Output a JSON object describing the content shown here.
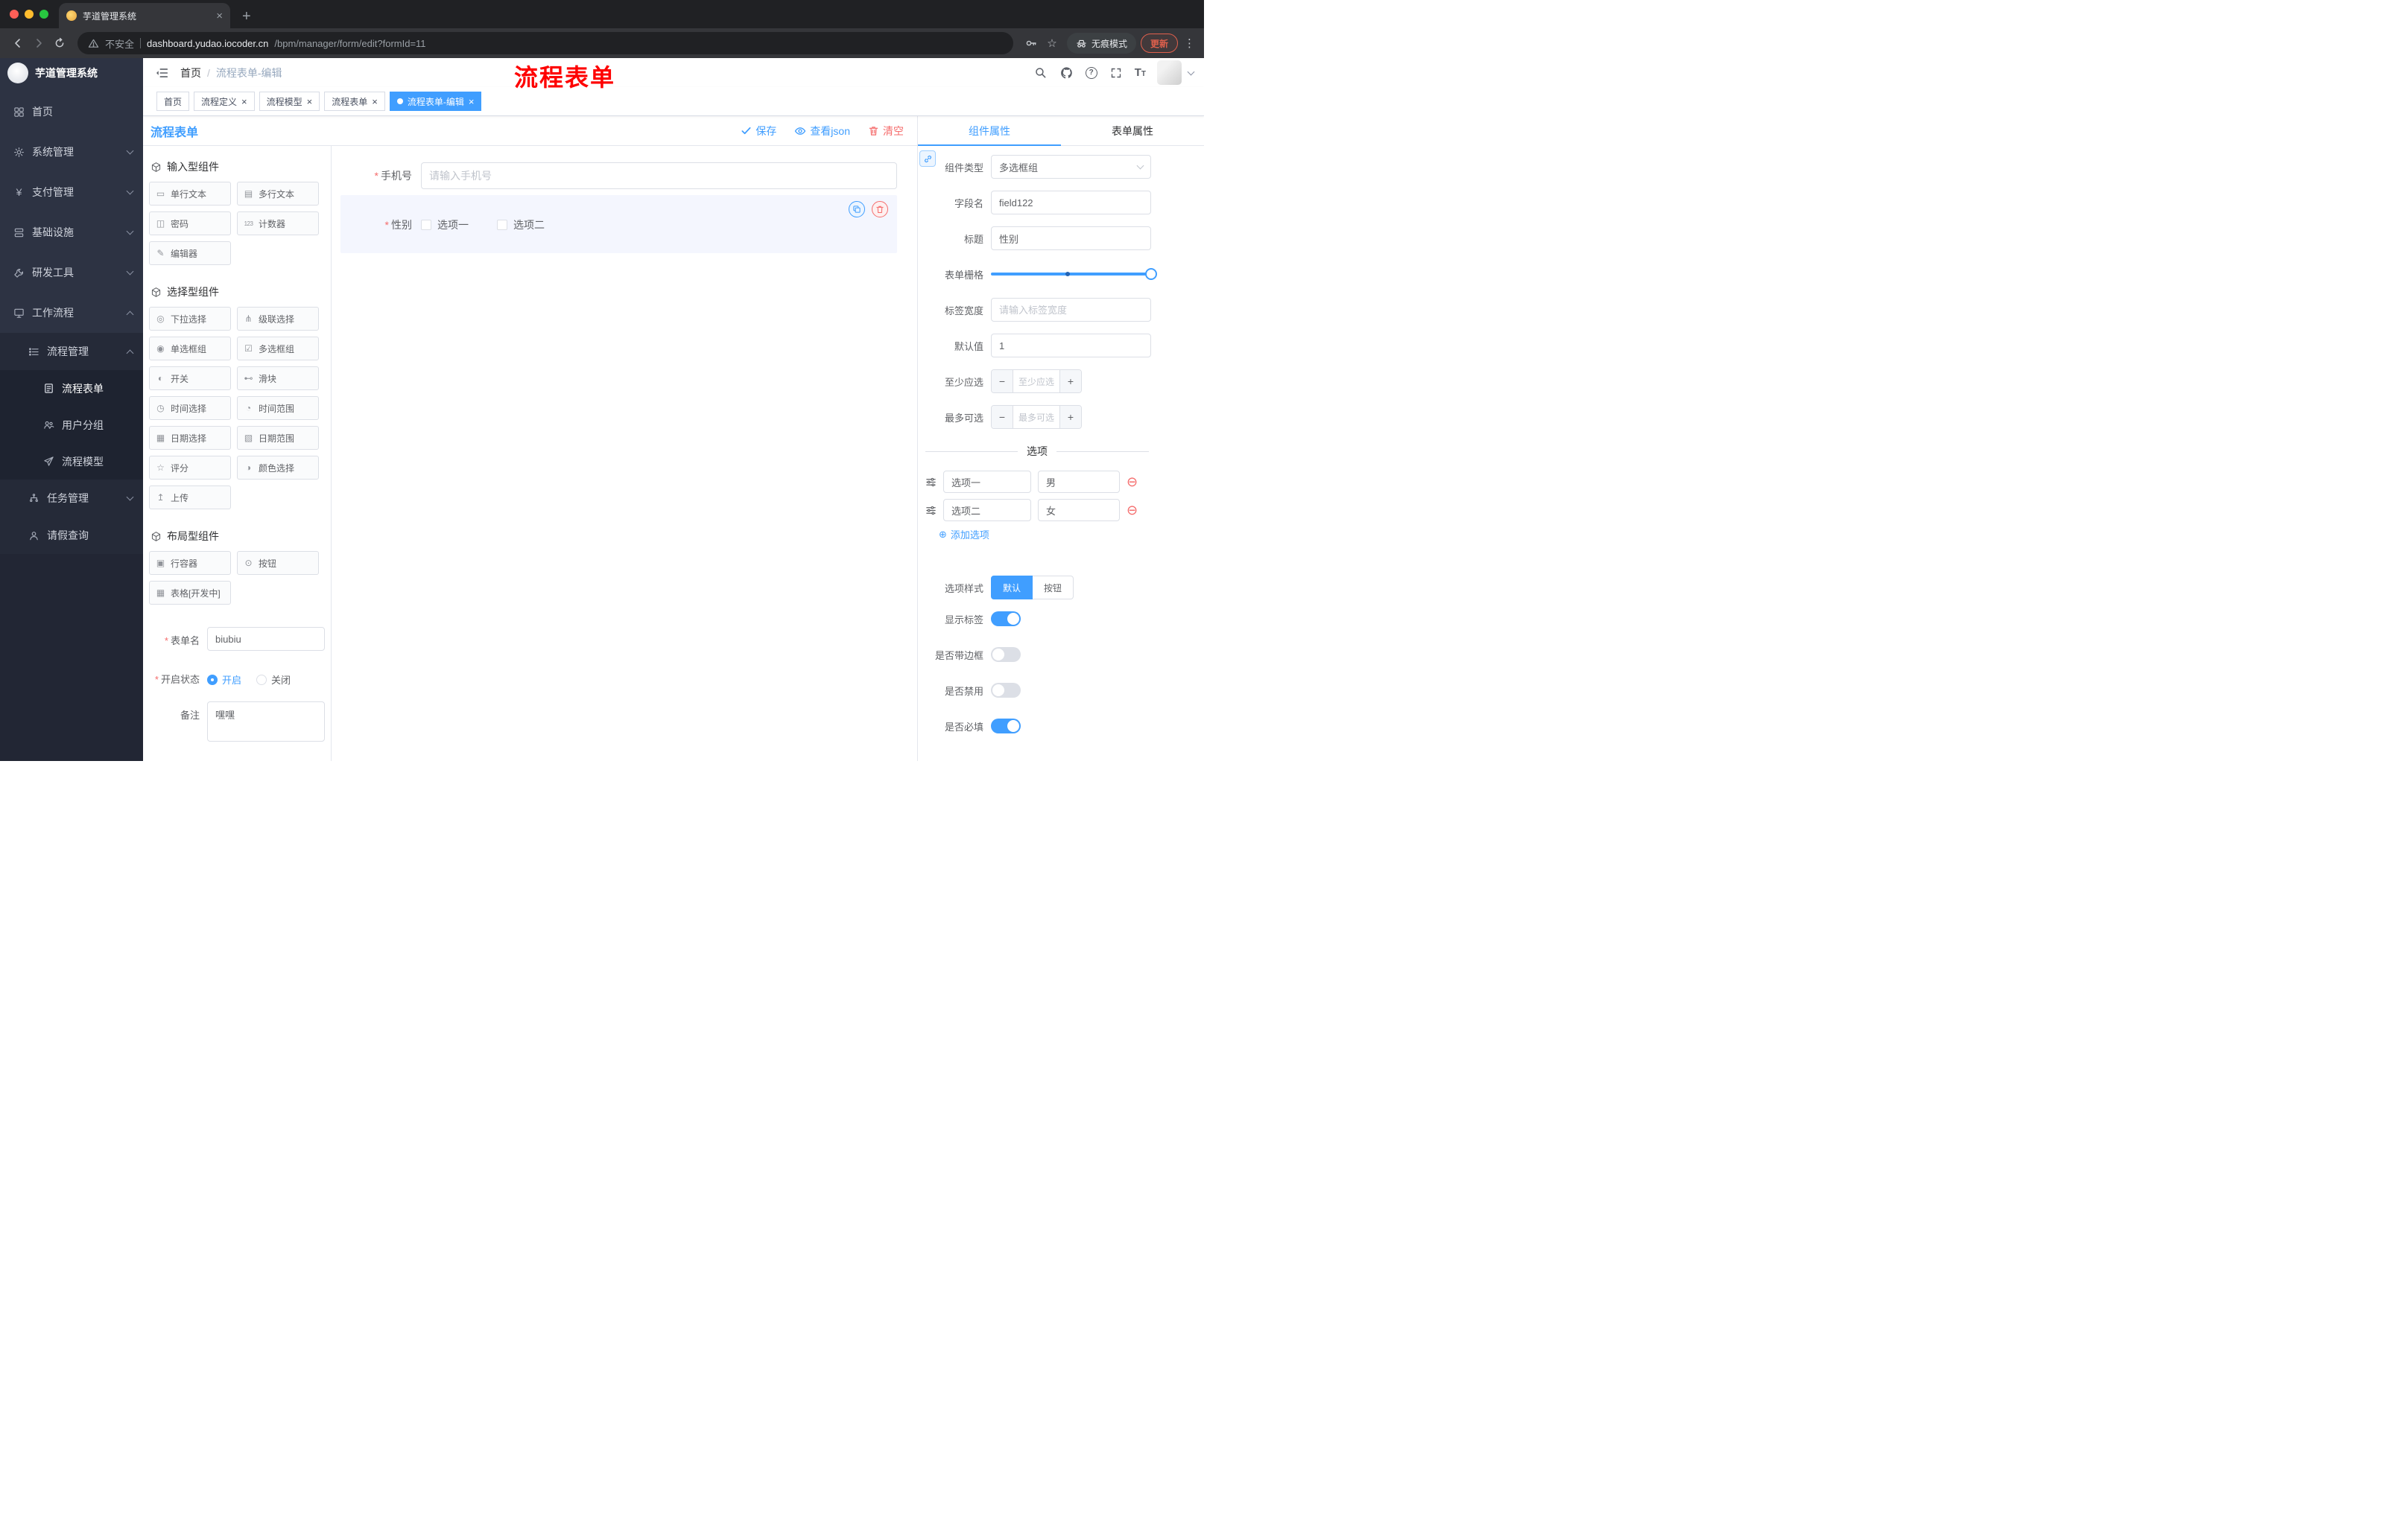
{
  "ui": {
    "required_mark": "*"
  },
  "icons": {
    "close": "×",
    "plus": "+",
    "more_vert": "⋮",
    "star": "☆",
    "question": "?",
    "add_circle": "⊕",
    "remove_circle": "⊖",
    "minus": "−",
    "yen": "¥",
    "font_size_big": "T",
    "font_size_small": "T"
  },
  "palette_icons": {
    "groups": [
      [
        "▭",
        "▤",
        "◫",
        "123",
        "✎"
      ],
      [
        "◎",
        "⋔",
        "◉",
        "☑",
        "◐",
        "⊷",
        "◷",
        "◔",
        "▦",
        "▧",
        "☆",
        "◑",
        "↥"
      ],
      [
        "▣",
        "⊙",
        "▦"
      ]
    ]
  },
  "browser": {
    "tab_title": "芋道管理系统",
    "security_label": "不安全",
    "url_domain": "dashboard.yudao.iocoder.cn",
    "url_path": "/bpm/manager/form/edit?formId=11",
    "incognito_label": "无痕模式",
    "update_label": "更新"
  },
  "sidebar": {
    "logo_title": "芋道管理系统",
    "items": [
      {
        "label": "首页"
      },
      {
        "label": "系统管理"
      },
      {
        "label": "支付管理"
      },
      {
        "label": "基础设施"
      },
      {
        "label": "研发工具"
      },
      {
        "label": "工作流程"
      },
      {
        "label": "流程管理"
      },
      {
        "label": "流程表单"
      },
      {
        "label": "用户分组"
      },
      {
        "label": "流程模型"
      },
      {
        "label": "任务管理"
      },
      {
        "label": "请假查询"
      }
    ]
  },
  "header": {
    "breadcrumb": {
      "home": "首页",
      "separator": "/",
      "current": "流程表单-编辑"
    },
    "annotation": "流程表单"
  },
  "nav_tabs": {
    "items": [
      {
        "label": "首页",
        "closable": false,
        "active": false
      },
      {
        "label": "流程定义",
        "closable": true,
        "active": false
      },
      {
        "label": "流程模型",
        "closable": true,
        "active": false
      },
      {
        "label": "流程表单",
        "closable": true,
        "active": false
      },
      {
        "label": "流程表单-编辑",
        "closable": true,
        "active": true
      }
    ]
  },
  "designer": {
    "title": "流程表单",
    "actions": {
      "save": "保存",
      "view_json": "查看json",
      "clear": "清空"
    },
    "palette": {
      "groups": [
        {
          "title": "输入型组件",
          "items": [
            "单行文本",
            "多行文本",
            "密码",
            "计数器",
            "编辑器"
          ]
        },
        {
          "title": "选择型组件",
          "items": [
            "下拉选择",
            "级联选择",
            "单选框组",
            "多选框组",
            "开关",
            "滑块",
            "时间选择",
            "时间范围",
            "日期选择",
            "日期范围",
            "评分",
            "颜色选择",
            "上传"
          ]
        },
        {
          "title": "布局型组件",
          "items": [
            "行容器",
            "按钮",
            "表格[开发中]"
          ]
        }
      ]
    },
    "form_meta": {
      "name_label": "表单名",
      "name_value": "biubiu",
      "status_label": "开启状态",
      "status_on": "开启",
      "status_off": "关闭",
      "remark_label": "备注",
      "remark_value": "嘿嘿"
    },
    "canvas": {
      "phone_label": "手机号",
      "phone_placeholder": "请输入手机号",
      "gender_label": "性别",
      "gender_option1": "选项一",
      "gender_option2": "选项二"
    }
  },
  "props": {
    "tab_component": "组件属性",
    "tab_form": "表单属性",
    "component_type": {
      "label": "组件类型",
      "value": "多选框组"
    },
    "field_name": {
      "label": "字段名",
      "value": "field122"
    },
    "title": {
      "label": "标题",
      "value": "性别"
    },
    "grid": {
      "label": "表单栅格"
    },
    "label_width": {
      "label": "标签宽度",
      "placeholder": "请输入标签宽度"
    },
    "default_value": {
      "label": "默认值",
      "value": "1"
    },
    "min_select": {
      "label": "至少应选",
      "placeholder": "至少应选"
    },
    "max_select": {
      "label": "最多可选",
      "placeholder": "最多可选"
    },
    "options_title": "选项",
    "options": [
      {
        "name": "选项一",
        "value": "男"
      },
      {
        "name": "选项二",
        "value": "女"
      }
    ],
    "add_option": "添加选项",
    "option_style": {
      "label": "选项样式",
      "choices": [
        "默认",
        "按钮"
      ],
      "selected": "默认"
    },
    "toggles": [
      {
        "label": "显示标签",
        "on": true
      },
      {
        "label": "是否带边框",
        "on": false
      },
      {
        "label": "是否禁用",
        "on": false
      },
      {
        "label": "是否必填",
        "on": true
      }
    ]
  }
}
